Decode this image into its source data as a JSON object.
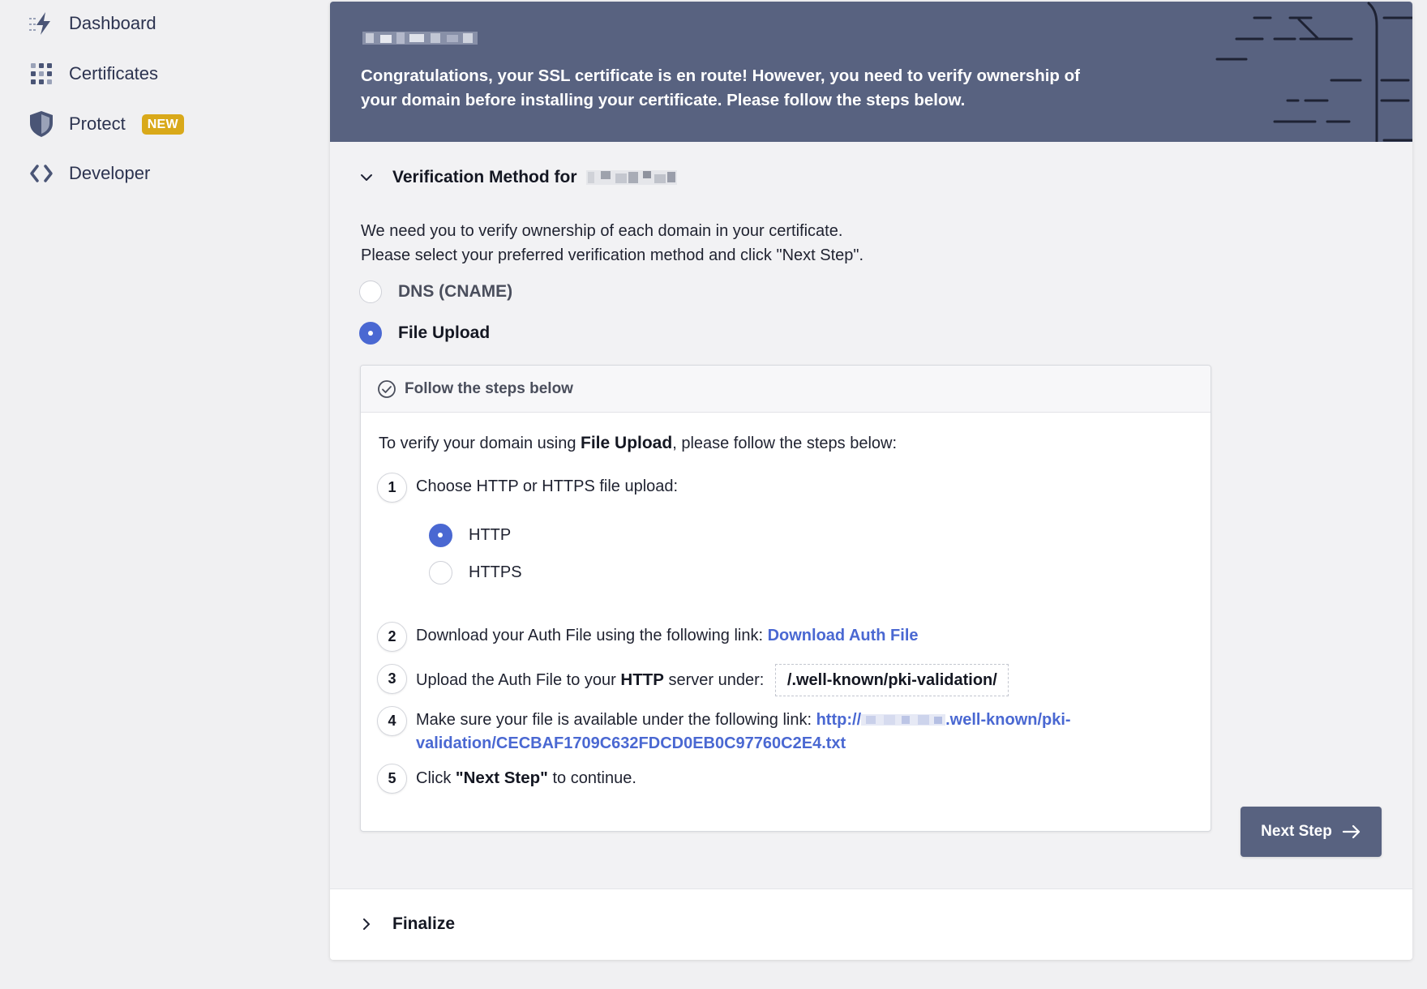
{
  "sidebar": {
    "items": [
      {
        "label": "Dashboard",
        "icon": "bolt-icon"
      },
      {
        "label": "Certificates",
        "icon": "grid-icon"
      },
      {
        "label": "Protect",
        "icon": "shield-icon",
        "badge": "NEW"
      },
      {
        "label": "Developer",
        "icon": "code-icon"
      }
    ]
  },
  "banner": {
    "message": "Congratulations, your SSL certificate is en route! However, you need to verify ownership of your domain before installing your certificate. Please follow the steps below."
  },
  "verification": {
    "title": "Verification Method for",
    "intro_line1": "We need you to verify ownership of each domain in your certificate.",
    "intro_line2": "Please select your preferred verification method and click \"Next Step\".",
    "methods": [
      {
        "label": "DNS (CNAME)",
        "selected": false
      },
      {
        "label": "File Upload",
        "selected": true
      }
    ]
  },
  "steps": {
    "header": "Follow the steps below",
    "intro_prefix": "To verify your domain using",
    "intro_method": "File Upload",
    "intro_suffix": ", please follow the steps below:",
    "step1": {
      "num": "1",
      "text": "Choose HTTP or HTTPS file upload:"
    },
    "protocols": [
      {
        "label": "HTTP",
        "selected": true
      },
      {
        "label": "HTTPS",
        "selected": false
      }
    ],
    "step2": {
      "num": "2",
      "text": "Download your Auth File using the following link:",
      "link": "Download Auth File"
    },
    "step3": {
      "num": "3",
      "prefix": "Upload the Auth File to your",
      "bold": "HTTP",
      "suffix": "server under:",
      "path": "/.well-known/pki-validation/"
    },
    "step4": {
      "num": "4",
      "text": "Make sure your file is available under the following link:",
      "link_prefix": "http://",
      "link_mid": ".well-known/pki-",
      "link_line2": "validation/CECBAF1709C632FDCD0EB0C97760C2E4.txt"
    },
    "step5": {
      "num": "5",
      "prefix": "Click",
      "bold": "\"Next Step\"",
      "suffix": "to continue."
    }
  },
  "next_button": {
    "label": "Next Step"
  },
  "finalize": {
    "title": "Finalize"
  },
  "colors": {
    "banner": "#586280",
    "accent": "#4a68d2",
    "badge": "#d9a91a"
  }
}
